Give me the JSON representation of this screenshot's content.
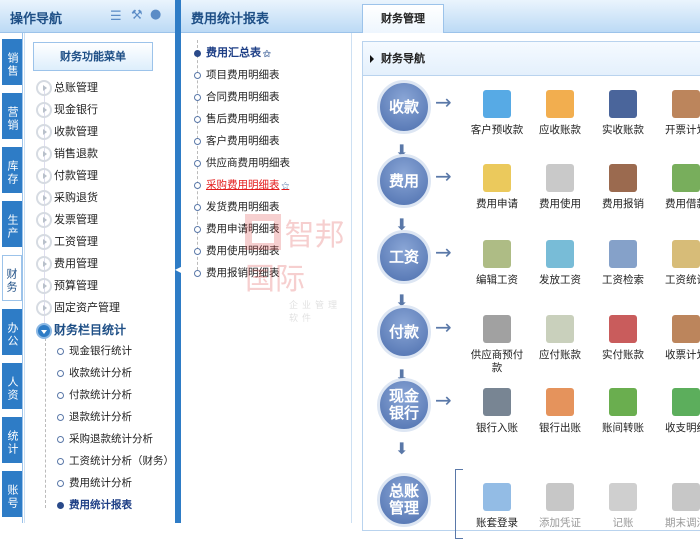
{
  "left": {
    "title": "操作导航",
    "header_icons": [
      "list-icon",
      "wrench-icon",
      "user-icon"
    ],
    "vtabs": [
      "销售",
      "营销",
      "库存",
      "生产",
      "财务",
      "办公",
      "人资",
      "统计",
      "账号"
    ],
    "menu_button": "财务功能菜单",
    "items": [
      "总账管理",
      "现金银行",
      "收款管理",
      "销售退款",
      "付款管理",
      "采购退货",
      "发票管理",
      "工资管理",
      "费用管理",
      "预算管理",
      "固定资产管理"
    ],
    "open_item": "财务栏目统计",
    "sub_items": [
      "现金银行统计",
      "收款统计分析",
      "付款统计分析",
      "退款统计分析",
      "采购退款统计分析",
      "工资统计分析（财务）",
      "费用统计分析",
      "费用统计报表"
    ]
  },
  "middle": {
    "title": "费用统计报表",
    "reports": [
      "费用汇总表",
      "项目费用明细表",
      "合同费用明细表",
      "售后费用明细表",
      "客户费用明细表",
      "供应商费用明细表",
      "采购费用明细表",
      "发货费用明细表",
      "费用申请明细表",
      "费用使用明细表",
      "费用报销明细表"
    ],
    "watermark": {
      "brand": "智邦国际",
      "tagline": "企业管理软件"
    }
  },
  "right": {
    "tab": "财务管理",
    "section": "财务导航",
    "rows": [
      {
        "stage": "收款",
        "items": [
          "客户预收款",
          "应收账款",
          "实收账款",
          "开票计划"
        ],
        "colors": [
          "#3a9be0",
          "#f0a030",
          "#2a4a8a",
          "#b07040"
        ]
      },
      {
        "stage": "费用",
        "items": [
          "费用申请",
          "费用使用",
          "费用报销",
          "费用借款"
        ],
        "colors": [
          "#e8c040",
          "#c0c0c0",
          "#8a5030",
          "#60a040"
        ]
      },
      {
        "stage": "工资",
        "items": [
          "编辑工资",
          "发放工资",
          "工资检索",
          "工资统计"
        ],
        "colors": [
          "#a0b070",
          "#60b0d0",
          "#7090c0",
          "#d0b060"
        ]
      },
      {
        "stage": "付款",
        "items": [
          "供应商预付款",
          "应付账款",
          "实付账款",
          "收票计划"
        ],
        "colors": [
          "#909090",
          "#c0c8b0",
          "#c04040",
          "#b07040"
        ]
      },
      {
        "stage": "现金\n银行",
        "items": [
          "银行入账",
          "银行出账",
          "账间转账",
          "收支明细"
        ],
        "colors": [
          "#607080",
          "#e08040",
          "#50a030",
          "#40a040"
        ]
      },
      {
        "stage": "总账\n管理",
        "items": [
          "账套登录",
          "添加凭证",
          "记账",
          "期末调汇"
        ],
        "colors": [
          "#80b0e0",
          "#909090",
          "#a0a0a0",
          "#909090"
        ],
        "disabled": [
          false,
          true,
          true,
          true
        ]
      }
    ]
  }
}
